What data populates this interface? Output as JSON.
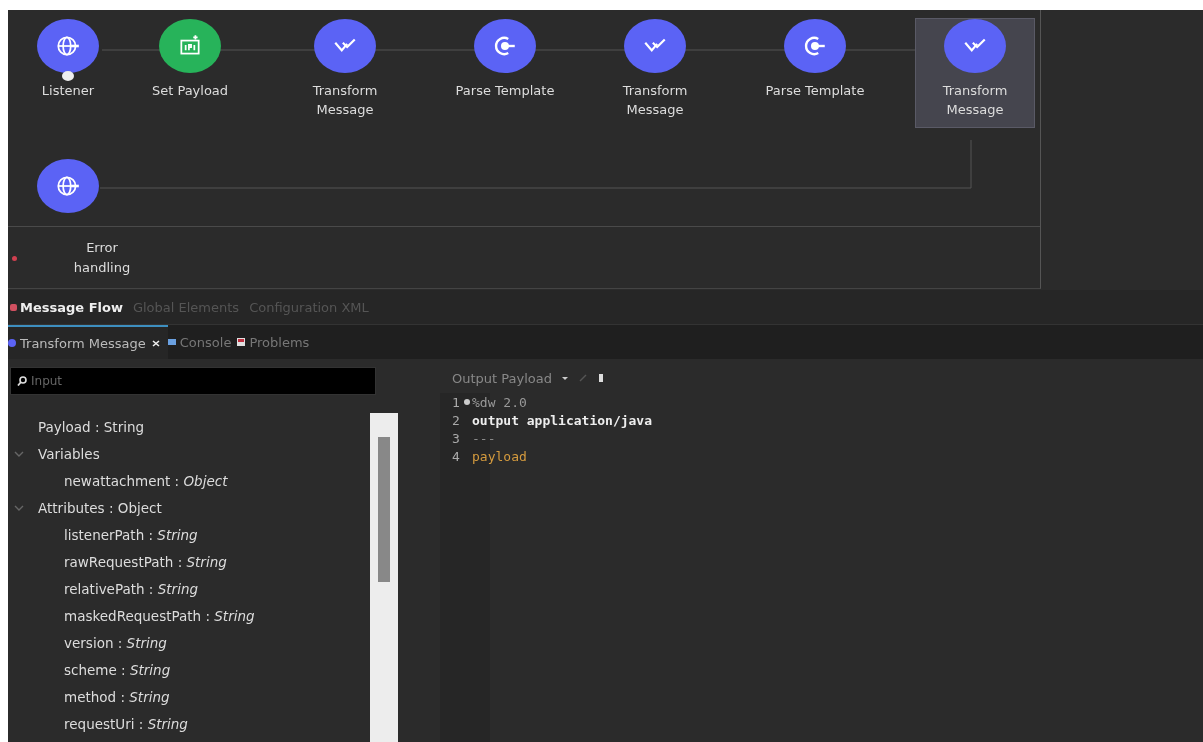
{
  "flow": {
    "nodes": [
      {
        "label": "Listener",
        "kind": "listener",
        "selected": false
      },
      {
        "label": "Set Payload",
        "kind": "set-payload",
        "selected": false
      },
      {
        "label": "Transform Message",
        "kind": "transform",
        "selected": false
      },
      {
        "label": "Parse Template",
        "kind": "parse",
        "selected": false
      },
      {
        "label": "Transform Message",
        "kind": "transform",
        "selected": false
      },
      {
        "label": "Parse Template",
        "kind": "parse",
        "selected": false
      },
      {
        "label": "Transform Message",
        "kind": "transform",
        "selected": true
      }
    ],
    "source": {
      "kind": "listener"
    },
    "error_handling": {
      "label": "Error handling"
    }
  },
  "editor_tabs": [
    {
      "label": "Message Flow",
      "selected": true
    },
    {
      "label": "Global Elements",
      "selected": false
    },
    {
      "label": "Configuration XML",
      "selected": false
    }
  ],
  "view_tabs": [
    {
      "label": "Transform Message",
      "kind": "transform",
      "selected": true,
      "closable": true
    },
    {
      "label": "Console",
      "kind": "console",
      "selected": false,
      "closable": false
    },
    {
      "label": "Problems",
      "kind": "problems",
      "selected": false,
      "closable": false
    }
  ],
  "input": {
    "search": {
      "placeholder": "Input"
    },
    "tree": [
      {
        "label": "Payload : String"
      },
      {
        "label": "Variables",
        "expanded": true,
        "children": [
          {
            "label": "newattachment : *Object*"
          }
        ]
      },
      {
        "label": "Attributes : Object",
        "expanded": true,
        "children": [
          {
            "label": "listenerPath : *String*"
          },
          {
            "label": "rawRequestPath : *String*"
          },
          {
            "label": "relativePath : *String*"
          },
          {
            "label": "maskedRequestPath : *String*"
          },
          {
            "label": "version : *String*"
          },
          {
            "label": "scheme : *String*"
          },
          {
            "label": "method : *String*"
          },
          {
            "label": "requestUri : *String*"
          }
        ]
      }
    ]
  },
  "output": {
    "title": "Output Payload",
    "code": [
      {
        "number": "1",
        "text": "%dw 2.0",
        "kind": "directive",
        "foldable": true
      },
      {
        "number": "2",
        "text": "output application/java",
        "kind": "keyword",
        "foldable": false
      },
      {
        "number": "3",
        "text": "---",
        "kind": "separator",
        "foldable": false
      },
      {
        "number": "4",
        "text": "payload",
        "kind": "expression",
        "foldable": false
      }
    ]
  }
}
